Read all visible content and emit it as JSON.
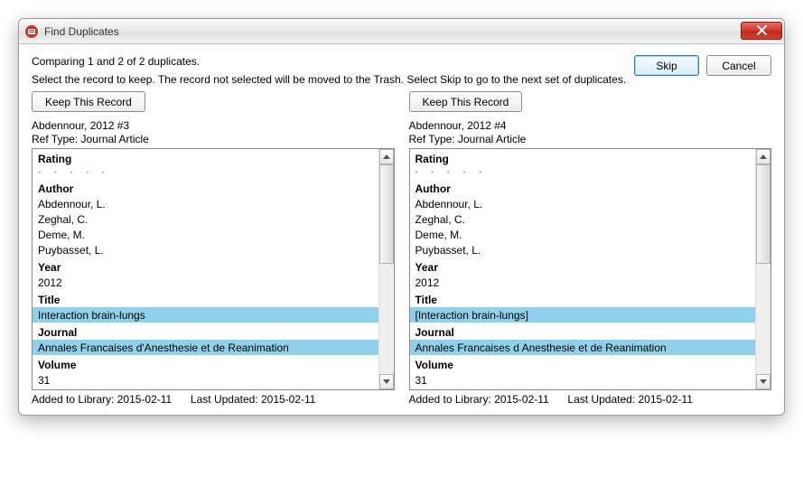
{
  "window": {
    "title": "Find Duplicates"
  },
  "messages": {
    "comparing": "Comparing 1 and 2 of 2 duplicates.",
    "instruction": "Select the record to keep. The record not selected will be moved to the Trash. Select Skip to go to the next set of duplicates."
  },
  "buttons": {
    "skip": "Skip",
    "cancel": "Cancel",
    "keep": "Keep This Record"
  },
  "labels": {
    "rating": "Rating",
    "author": "Author",
    "year": "Year",
    "title": "Title",
    "journal": "Journal",
    "volume": "Volume",
    "added": "Added to Library:",
    "updated": "Last Updated:"
  },
  "left": {
    "header": "Abdennour, 2012 #3",
    "refType": "Ref Type: Journal Article",
    "authors": [
      "Abdennour, L.",
      "Zeghal, C.",
      "Deme, M.",
      "Puybasset, L."
    ],
    "year": "2012",
    "title": "Interaction brain-lungs",
    "journal": "Annales Francaises d'Anesthesie et de Reanimation",
    "volume": "31",
    "added": "2015-02-11",
    "updated": "2015-02-11"
  },
  "right": {
    "header": "Abdennour, 2012 #4",
    "refType": "Ref Type: Journal Article",
    "authors": [
      "Abdennour, L.",
      "Zeghal, C.",
      "Deme, M.",
      "Puybasset, L."
    ],
    "year": "2012",
    "title": "[Interaction brain-lungs]",
    "journal": "Annales Francaises d Anesthesie et de Reanimation",
    "volume": "31",
    "added": "2015-02-11",
    "updated": "2015-02-11"
  },
  "colors": {
    "highlight": "#8fd1eb",
    "close_red": "#c93224"
  }
}
